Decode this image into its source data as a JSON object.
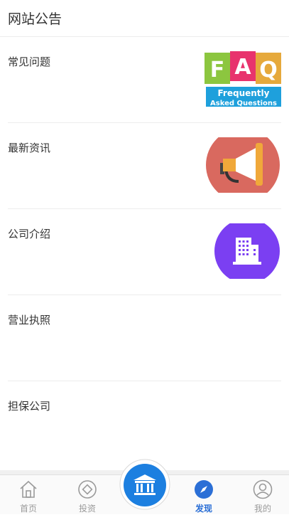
{
  "header": {
    "title": "网站公告"
  },
  "items": [
    {
      "label": "常见问题",
      "icon": "faq-image"
    },
    {
      "label": "最新资讯",
      "icon": "megaphone-image"
    },
    {
      "label": "公司介绍",
      "icon": "building-image"
    },
    {
      "label": "营业执照",
      "icon": ""
    },
    {
      "label": "担保公司",
      "icon": ""
    }
  ],
  "faq_text": {
    "f": "F",
    "a": "A",
    "q": "Q",
    "line1": "Frequently",
    "line2": "Asked Questions"
  },
  "tabbar": {
    "home": "首页",
    "invest": "投资",
    "discover": "发现",
    "mine": "我的"
  },
  "colors": {
    "accent": "#2b6fd6",
    "building_purple": "#7b3ff2",
    "megaphone_bg": "#d9695f"
  }
}
